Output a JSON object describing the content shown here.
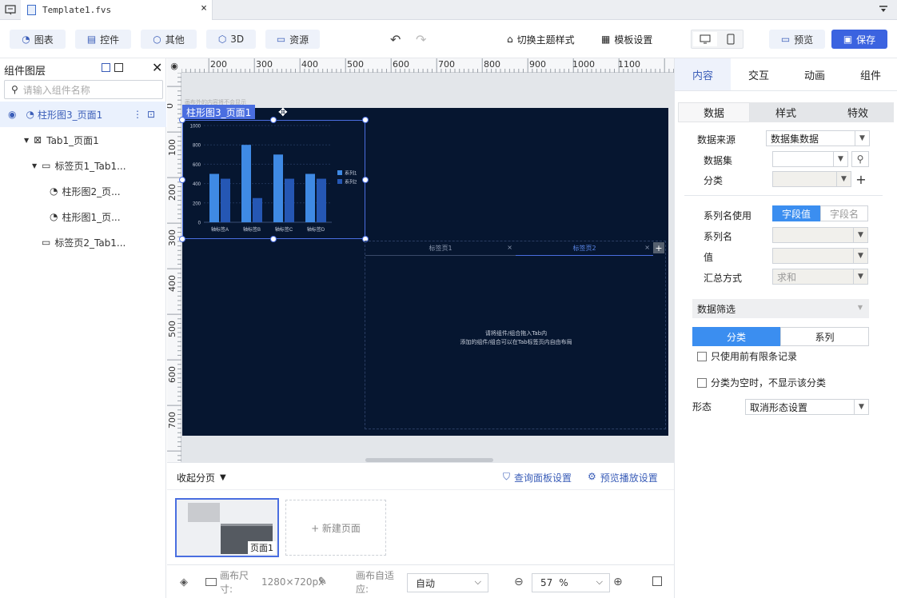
{
  "tabbar": {
    "file_tab": "Template1.fvs",
    "close": "×"
  },
  "toolbar": {
    "buttons": [
      {
        "label": "图表",
        "icon": "pie-icon"
      },
      {
        "label": "控件",
        "icon": "widget-icon"
      },
      {
        "label": "其他",
        "icon": "circle-icon"
      },
      {
        "label": "3D",
        "icon": "cube-icon"
      },
      {
        "label": "资源",
        "icon": "box-icon"
      }
    ],
    "switch_theme": "切换主题样式",
    "template_settings": "模板设置",
    "preview": "预览",
    "save": "保存"
  },
  "layers": {
    "title": "组件图层",
    "search_placeholder": "请输入组件名称",
    "items": [
      {
        "label": "柱形图3_页面1"
      },
      {
        "label": "Tab1_页面1"
      },
      {
        "label": "标签页1_Tab1..."
      },
      {
        "label": "柱形图2_页..."
      },
      {
        "label": "柱形图1_页..."
      },
      {
        "label": "标签页2_Tab1..."
      }
    ]
  },
  "ruler": {
    "top": [
      "200",
      "300",
      "400",
      "500",
      "600",
      "700",
      "800",
      "900",
      "1000",
      "1100"
    ],
    "left": [
      "0",
      "100",
      "200",
      "300",
      "400",
      "500",
      "600",
      "700"
    ]
  },
  "canvas": {
    "hint": "画布外的内容将不会显示",
    "selected_label": "柱形图3_页面1",
    "tab_titles": [
      "标签页1",
      "标签页2"
    ],
    "tab_close": "×",
    "tab_add": "+",
    "drop_hint_1": "请将组件/组合拖入Tab内",
    "drop_hint_2": "添加的组件/组合可以在Tab标签页内自由布局"
  },
  "chart_data": {
    "type": "bar",
    "categories": [
      "轴标签A",
      "轴标签B",
      "轴标签C",
      "轴标签D"
    ],
    "series": [
      {
        "name": "系列1",
        "values": [
          500,
          800,
          700,
          500
        ],
        "color": "#3f8ae4"
      },
      {
        "name": "系列2",
        "values": [
          450,
          250,
          450,
          450
        ],
        "color": "#2557b4"
      }
    ],
    "yticks": [
      "0",
      "200",
      "400",
      "600",
      "800",
      "1000"
    ],
    "ylim": [
      0,
      1000
    ],
    "legend_position": "right"
  },
  "pages": {
    "collapse": "收起分页",
    "query_panel": "查询面板设置",
    "preview_play": "预览播放设置",
    "page_label": "页面1",
    "new_page": "+ 新建页面"
  },
  "status": {
    "canvas_size_label": "画布尺寸:",
    "canvas_size": "1280×720px",
    "adapt_label": "画布自适应:",
    "adapt_value": "自动",
    "zoom": "57",
    "zoom_unit": "%"
  },
  "props": {
    "tabs": [
      "内容",
      "交互",
      "动画",
      "组件"
    ],
    "subtabs": [
      "数据",
      "样式",
      "特效"
    ],
    "data_source_label": "数据来源",
    "data_source_value": "数据集数据",
    "dataset_label": "数据集",
    "category_label": "分类",
    "series_name_use_label": "系列名使用",
    "field_value": "字段值",
    "field_name": "字段名",
    "series_name_label": "系列名",
    "value_label": "值",
    "agg_label": "汇总方式",
    "agg_value": "求和",
    "filter_title": "数据筛选",
    "filter_tabs": [
      "分类",
      "系列"
    ],
    "only_limited": "只使用前有限条记录",
    "hide_empty": "分类为空时，不显示该分类",
    "form_label": "形态",
    "form_value": "取消形态设置"
  },
  "colors": {
    "accent": "#4a6ee0",
    "canvas_bg": "#061630",
    "save_bg": "#3b63e0"
  }
}
